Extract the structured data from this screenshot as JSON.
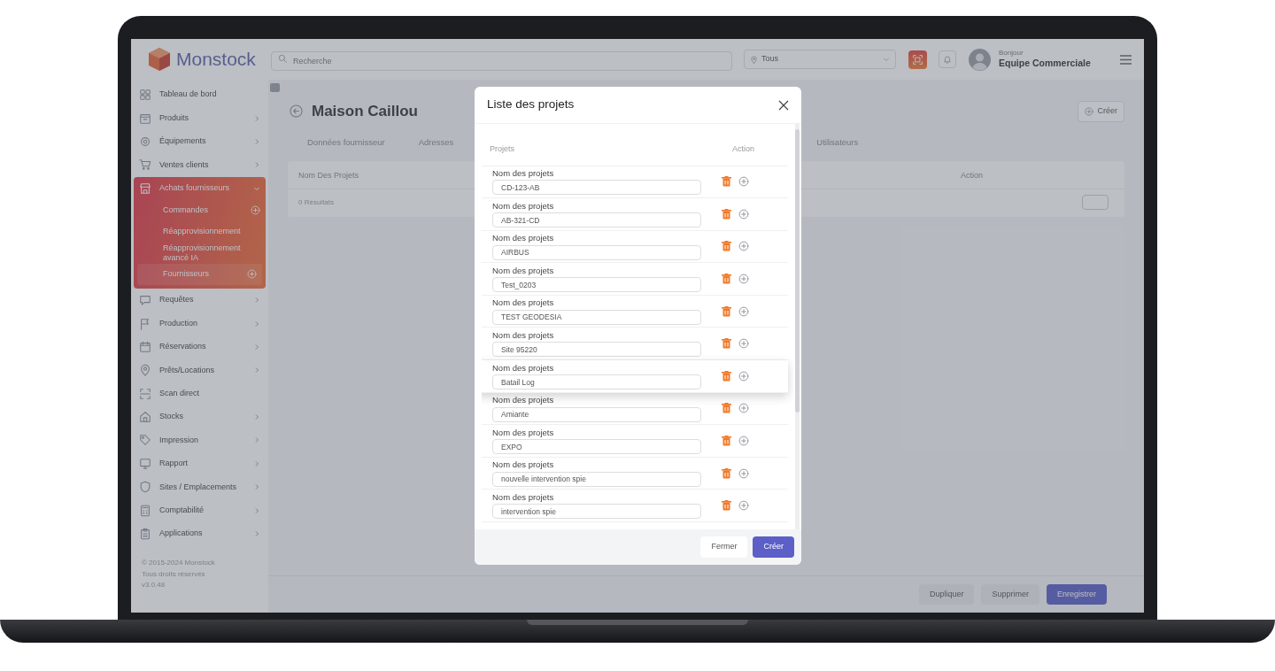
{
  "header": {
    "logo_text": "Monstock",
    "search": {
      "placeholder": "Recherche"
    },
    "site_filter": {
      "value": "Tous"
    },
    "greeting": "Bonjour",
    "user_name": "Equipe Commerciale"
  },
  "sidebar": {
    "items": [
      {
        "label": "Tableau de bord",
        "expandable": false,
        "expanded": false
      },
      {
        "label": "Produits",
        "expandable": true,
        "expanded": false
      },
      {
        "label": "Équipements",
        "expandable": true,
        "expanded": false
      },
      {
        "label": "Ventes clients",
        "expandable": true,
        "expanded": false
      },
      {
        "label": "Achats fournisseurs",
        "expandable": true,
        "expanded": true,
        "children": [
          {
            "label": "Commandes",
            "add_button": true,
            "selected": false
          },
          {
            "label": "Réapprovisionnement",
            "add_button": false,
            "selected": false
          },
          {
            "label": "Réapprovisionnement avancé IA",
            "add_button": false,
            "selected": false
          },
          {
            "label": "Fournisseurs",
            "add_button": true,
            "selected": true
          }
        ]
      },
      {
        "label": "Requêtes",
        "expandable": true,
        "expanded": false
      },
      {
        "label": "Production",
        "expandable": true,
        "expanded": false
      },
      {
        "label": "Réservations",
        "expandable": true,
        "expanded": false
      },
      {
        "label": "Prêts/Locations",
        "expandable": true,
        "expanded": false
      },
      {
        "label": "Scan direct",
        "expandable": false,
        "expanded": false
      },
      {
        "label": "Stocks",
        "expandable": true,
        "expanded": false
      },
      {
        "label": "Impression",
        "expandable": true,
        "expanded": false
      },
      {
        "label": "Rapport",
        "expandable": true,
        "expanded": false
      },
      {
        "label": "Sites / Emplacements",
        "expandable": true,
        "expanded": false
      },
      {
        "label": "Comptabilité",
        "expandable": true,
        "expanded": false
      },
      {
        "label": "Applications",
        "expandable": true,
        "expanded": false
      }
    ],
    "footer": [
      "© 2015-2024 Monstock",
      "Tous droits réservés",
      "v3.0.48"
    ]
  },
  "page": {
    "title": "Maison Caillou",
    "create_button": "Créer",
    "tabs": [
      {
        "label": "Données fournisseur",
        "selected": false
      },
      {
        "label": "Adresses",
        "selected": false
      },
      {
        "label": "Utilisateurs",
        "selected": false
      }
    ],
    "table": {
      "columns": [
        "Nom Des Projets",
        "Action"
      ],
      "result_count": "0 Résultats"
    },
    "actions": [
      {
        "label": "Dupliquer",
        "kind": "secondary"
      },
      {
        "label": "Supprimer",
        "kind": "secondary"
      },
      {
        "label": "Enregistrer",
        "kind": "primary"
      }
    ]
  },
  "modal": {
    "title": "Liste des projets",
    "columns": [
      "Projets",
      "Action"
    ],
    "rows": [
      {
        "label": "Nom des projets",
        "value": "CD-123-AB",
        "raised": false
      },
      {
        "label": "Nom des projets",
        "value": "AB-321-CD",
        "raised": false
      },
      {
        "label": "Nom des projets",
        "value": "AIRBUS",
        "raised": false
      },
      {
        "label": "Nom des projets",
        "value": "Test_0203",
        "raised": false
      },
      {
        "label": "Nom des projets",
        "value": "TEST GEODESIA",
        "raised": false
      },
      {
        "label": "Nom des projets",
        "value": "Site 95220",
        "raised": false
      },
      {
        "label": "Nom des projets",
        "value": "Batail Log",
        "raised": true
      },
      {
        "label": "Nom des projets",
        "value": "Amiante",
        "raised": false
      },
      {
        "label": "Nom des projets",
        "value": "EXPO",
        "raised": false
      },
      {
        "label": "Nom des projets",
        "value": "nouvelle intervention spie",
        "raised": false
      },
      {
        "label": "Nom des projets",
        "value": "intervention spie",
        "raised": false
      }
    ],
    "buttons": [
      {
        "label": "Fermer",
        "kind": "secondary"
      },
      {
        "label": "Créer",
        "kind": "primary"
      }
    ]
  }
}
